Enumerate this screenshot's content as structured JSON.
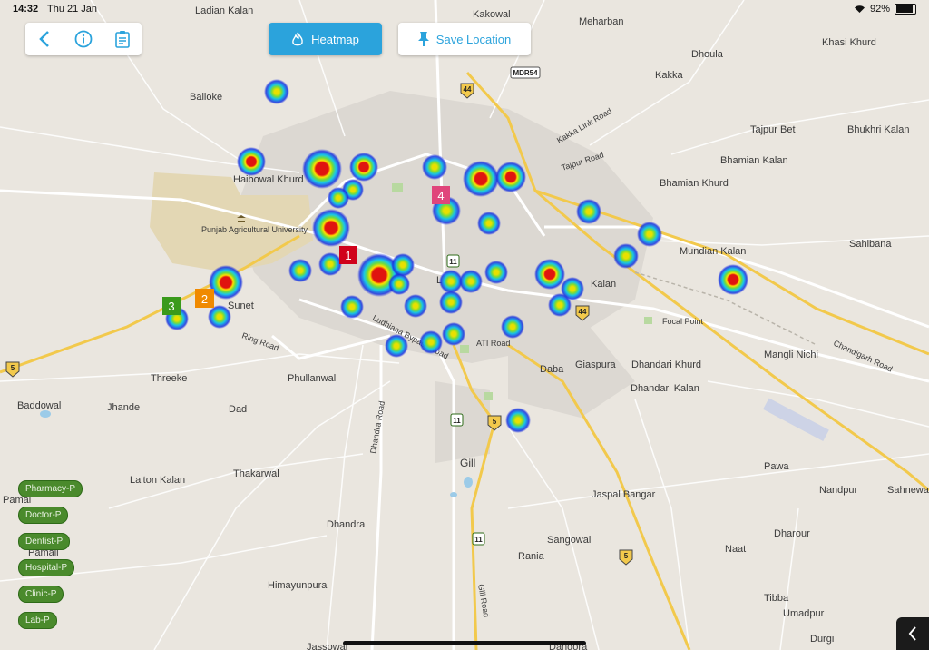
{
  "status_bar": {
    "time": "14:32",
    "date": "Thu 21 Jan",
    "battery": "92%"
  },
  "toolbar": {
    "back": "back-arrow",
    "info": "info",
    "report": "clipboard"
  },
  "heatmap_button": {
    "label": "Heatmap",
    "icon": "flame-icon"
  },
  "save_location_button": {
    "label": "Save Location",
    "icon": "pin-icon"
  },
  "colors": {
    "accent": "#2ba3dc",
    "legend_green": "#4a8a2c",
    "road_yellow": "#f2c94c",
    "marker_red": "#d0021b",
    "marker_orange": "#f08a00",
    "marker_green": "#3a9a1b",
    "marker_pink": "#e0457b"
  },
  "map_labels": [
    "Ladian Kalan",
    "Kakowal",
    "Meharban",
    "Khasi Khurd",
    "Dhoula",
    "Kakka",
    "Balloke",
    "Kakka Link Road",
    "Tajpur Bet",
    "Bhukhri Kalan",
    "Tajpur Road",
    "Bhamian Kalan",
    "Haibowal Khurd",
    "Bhamian Khurd",
    "Punjab Agricultural University",
    "Sahibana",
    "Mundian Kalan",
    "Sunet",
    "Focal Point",
    "Ring Road",
    "Ludhiana Bypass Road",
    "ATI Road",
    "Mangli Nichi",
    "Chandigarh Road",
    "Threeke",
    "Phullanwal",
    "Daba",
    "Giaspura",
    "Dhandari Khurd",
    "Dhandari Kalan",
    "Baddowal",
    "Jhande",
    "Dad",
    "Gill",
    "Dhandra Road",
    "Lalton Kalan",
    "Thakarwal",
    "Pawa",
    "Nandpur",
    "Sahnewal",
    "Jaspal Bangar",
    "Pamal",
    "Pamali",
    "Dhandra",
    "Sangowal",
    "Dharour",
    "Rania",
    "Gill Road",
    "Naat",
    "Himayunpura",
    "Tibba",
    "Umadpur",
    "Durgi",
    "Jassowal",
    "Dangora",
    "MDR54",
    "44",
    "5",
    "11",
    "Kalan",
    "L"
  ],
  "markers": [
    "1",
    "2",
    "3",
    "4"
  ],
  "legend": [
    "Pharmacy-P",
    "Doctor-P",
    "Dentist-P",
    "Hospital-P",
    "Clinic-P",
    "Lab-P"
  ],
  "corner_button": {
    "icon": "chevron-left-icon"
  }
}
